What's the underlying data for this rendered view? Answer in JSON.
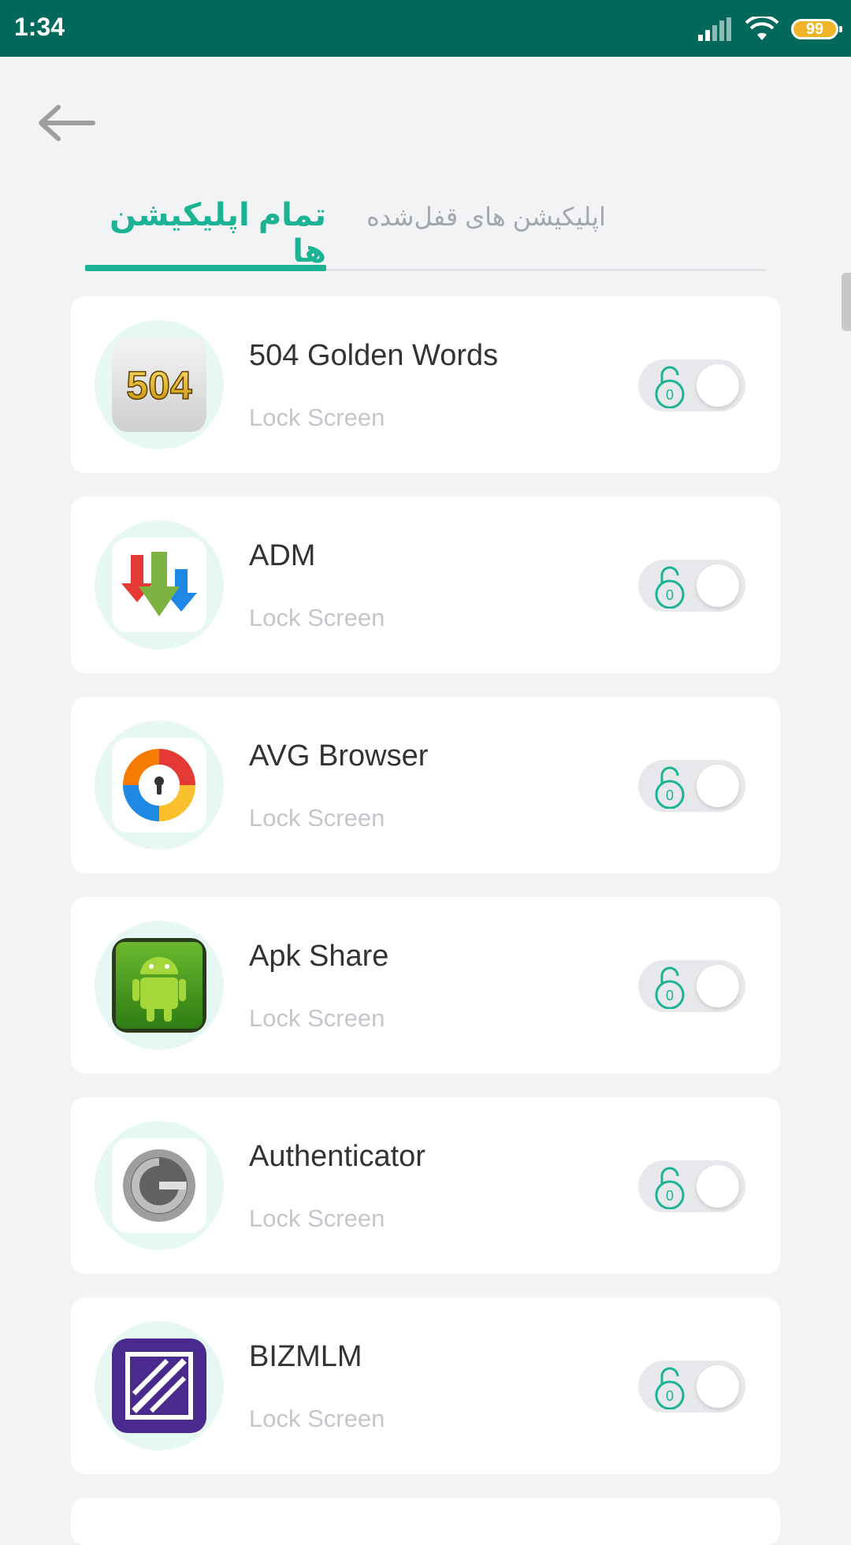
{
  "status_bar": {
    "time": "1:34",
    "battery": "99",
    "icons": [
      "signal-icon",
      "wifi-icon",
      "battery-icon"
    ]
  },
  "header": {
    "back_icon": "arrow-left-icon"
  },
  "tabs": [
    {
      "label": "تمام اپلیکیشن ها",
      "active": true
    },
    {
      "label": "اپلیکیشن های قفل‌شده",
      "active": false
    }
  ],
  "colors": {
    "status_bar": "#00695c",
    "accent": "#1cb394",
    "background": "#f2f3f5"
  },
  "apps": [
    {
      "name": "504 Golden Words",
      "subtitle": "Lock Screen",
      "icon": "504-golden-words-icon",
      "locked": false
    },
    {
      "name": "ADM",
      "subtitle": "Lock Screen",
      "icon": "adm-download-icon",
      "locked": false
    },
    {
      "name": "AVG Browser",
      "subtitle": "Lock Screen",
      "icon": "avg-browser-icon",
      "locked": false
    },
    {
      "name": "Apk Share",
      "subtitle": "Lock Screen",
      "icon": "android-robot-icon",
      "locked": false
    },
    {
      "name": "Authenticator",
      "subtitle": "Lock Screen",
      "icon": "authenticator-icon",
      "locked": false
    },
    {
      "name": "BIZMLM",
      "subtitle": "Lock Screen",
      "icon": "bizmlm-icon",
      "locked": false
    }
  ]
}
